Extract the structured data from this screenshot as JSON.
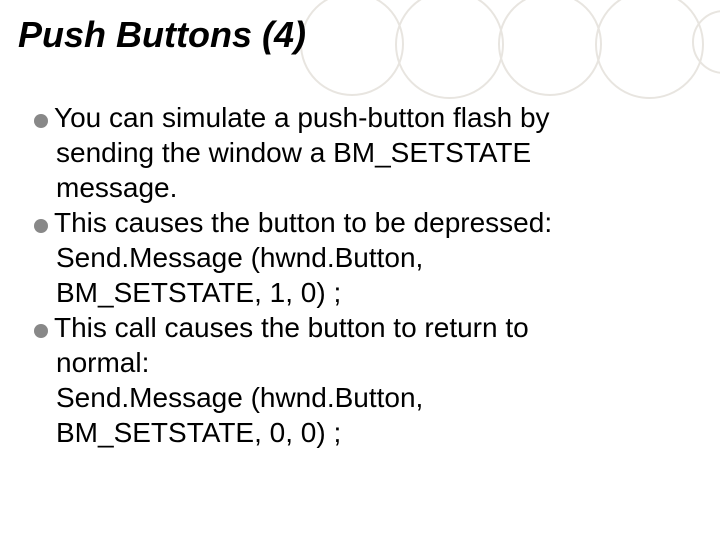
{
  "title": "Push Buttons  (4)",
  "bullets": [
    {
      "lines": [
        "You can simulate a push-button flash by",
        "sending the window a BM_SETSTATE",
        "message."
      ]
    },
    {
      "lines": [
        "This causes the button to be depressed:",
        "Send.Message (hwnd.Button,",
        "BM_SETSTATE, 1, 0) ;"
      ]
    },
    {
      "lines": [
        "This call causes the button to return to",
        "normal:",
        "Send.Message (hwnd.Button,",
        "BM_SETSTATE, 0, 0) ;"
      ]
    }
  ]
}
